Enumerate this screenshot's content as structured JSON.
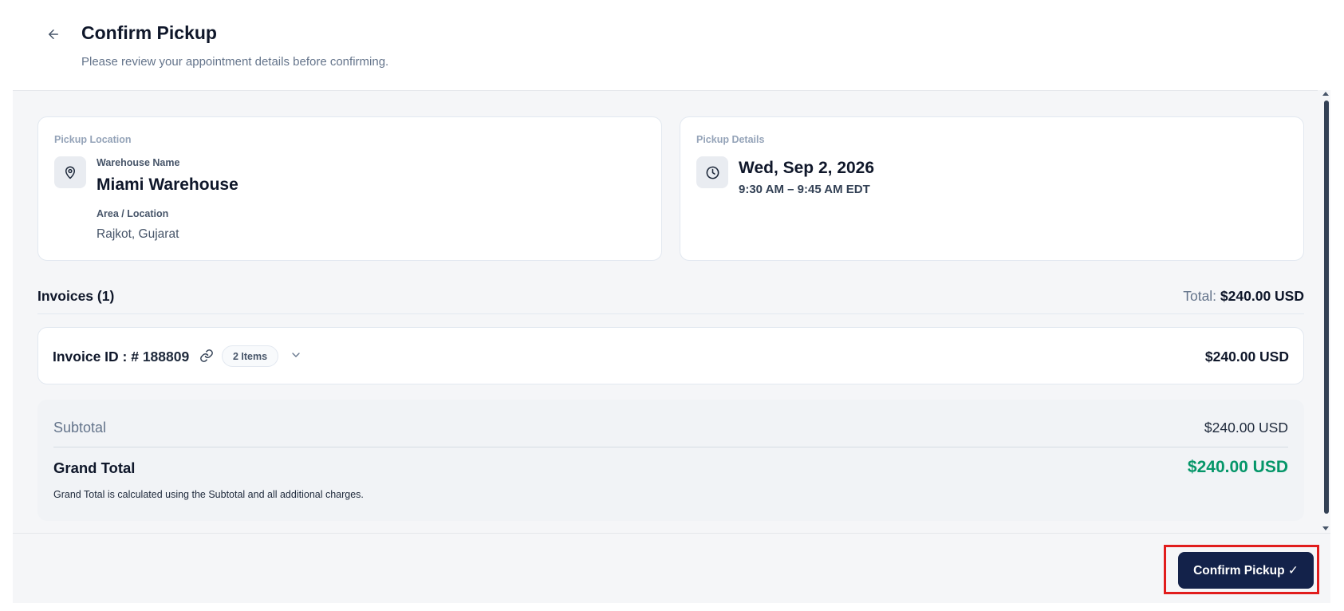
{
  "header": {
    "title": "Confirm Pickup",
    "subtitle": "Please review your appointment details before confirming."
  },
  "pickup_location": {
    "section_label": "Pickup Location",
    "warehouse_label": "Warehouse Name",
    "warehouse_name": "Miami Warehouse",
    "area_label": "Area / Location",
    "area_value": "Rajkot, Gujarat"
  },
  "pickup_details": {
    "section_label": "Pickup Details",
    "date": "Wed, Sep 2, 2026",
    "time": "9:30 AM – 9:45 AM EDT"
  },
  "invoices": {
    "title": "Invoices (1)",
    "total_label": "Total:",
    "total_value": "$240.00 USD",
    "items": [
      {
        "id_label": "Invoice ID : #",
        "id_number": "188809",
        "items_badge": "2 Items",
        "amount": "$240.00 USD"
      }
    ]
  },
  "summary": {
    "subtotal_label": "Subtotal",
    "subtotal_value": "$240.00 USD",
    "grand_total_label": "Grand Total",
    "grand_total_value": "$240.00 USD",
    "note": "Grand Total is calculated using the Subtotal and all additional charges."
  },
  "footer": {
    "confirm_label": "Confirm Pickup ✓"
  },
  "colors": {
    "primary": "#13224a",
    "success": "#059669",
    "highlight": "#e11d1d"
  },
  "icons": {
    "back": "arrow-left-icon",
    "location": "map-pin-icon",
    "time": "clock-icon",
    "link": "link-icon",
    "expand": "chevron-down-icon"
  }
}
